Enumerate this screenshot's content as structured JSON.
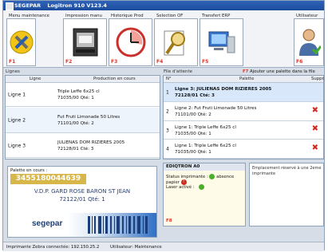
{
  "window": {
    "brand": "SEGEPAR",
    "title": "Logitron 910 V123.4"
  },
  "toolbar": {
    "buttons": [
      {
        "label": "Menu maintenance",
        "key": "F1",
        "icon": "wrench-screwdriver-icon"
      },
      {
        "label": "Impression manu",
        "key": "F2",
        "icon": "printer-icon"
      },
      {
        "label": "Historique Prod",
        "key": "F3",
        "icon": "clock-icon"
      },
      {
        "label": "Selection OF",
        "key": "F4",
        "icon": "magnifier-icon"
      },
      {
        "label": "Transfert ERP",
        "key": "F5",
        "icon": "computer-icon"
      },
      {
        "label": "Utilisateur",
        "key": "F6",
        "icon": "user-icon"
      }
    ]
  },
  "lignes": {
    "title": "Lignes",
    "col_ligne": "Ligne",
    "col_production": "Production en cours",
    "rows": [
      {
        "ligne": "Ligne 1",
        "product": "Triple Leffe 6x25 cl",
        "detail": "71035/00   Qté: 1"
      },
      {
        "ligne": "Ligne 2",
        "product": "Fut Fruti Limonade 50 Litres",
        "detail": "71101/00   Qté: 2"
      },
      {
        "ligne": "Ligne 3",
        "product": "JULIENAS DOM RIZIERES 2005",
        "detail": "72128/01  Cté: 3"
      }
    ]
  },
  "file_attente": {
    "title": "File d'attente",
    "add_key": "F7",
    "add_label": "Ajouter une palette dans la file",
    "col_n": "N°",
    "col_palette": "Palette",
    "col_suppr": "Suppr.",
    "rows": [
      {
        "n": "1",
        "line1": "Ligne 3: JULIENAS DOM RIZIERES 2005",
        "line2": "72128/01  Cté: 3",
        "selected": true
      },
      {
        "n": "2",
        "line1": "Ligne 2: Fut Fruti Limonade 50 Litres",
        "line2": "71101/00   Qté: 2",
        "selected": false
      },
      {
        "n": "3",
        "line1": "Ligne 1: Triple Leffe 6x25 cl",
        "line2": "71035/00   Qté: 1",
        "selected": false
      },
      {
        "n": "4",
        "line1": "Ligne 1: Triple Leffe 6x25 cl",
        "line2": "71035/00   Qté: 1",
        "selected": false
      }
    ]
  },
  "palette_en_cours": {
    "label": "Palette en cours :",
    "number": "3455180044639",
    "line1": "V.D.P. GARD ROSE BARON ST JEAN",
    "line2": "72122/01   Qté: 1",
    "logo": "segepar"
  },
  "etiqueteur": {
    "title": "EDIQTRON A0",
    "status_label": "Status imprimante :",
    "absence_label": "absence papier",
    "laser_label": "Laser activé :",
    "key": "F8",
    "reserved": "Emplacement réservé à une 2eme imprimante"
  },
  "statusbar": {
    "printer": "Imprimante Zebra connectée: 192.150.25.2",
    "user": "Utilisateur: Maintenance"
  },
  "colors": {
    "titlebar": "#2458b0",
    "selected_row": "#d8e8fa",
    "palette_number_bg": "#d7b64a",
    "alert": "#d02a20",
    "ok": "#4caf2a"
  }
}
